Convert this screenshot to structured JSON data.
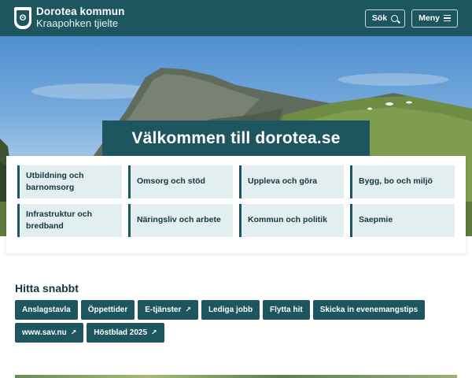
{
  "header": {
    "title": "Dorotea kommun",
    "subtitle": "Kraapohken tjielte",
    "search_label": "Sök",
    "menu_label": "Meny",
    "crest_icon": "bear-crest-icon",
    "bg_color": "#1e5660"
  },
  "hero": {
    "title": "Välkommen till dorotea.se"
  },
  "categories": [
    {
      "label": "Utbildning och barnomsorg"
    },
    {
      "label": "Omsorg och stöd"
    },
    {
      "label": "Uppleva och göra"
    },
    {
      "label": "Bygg, bo och miljö"
    },
    {
      "label": "Infrastruktur och bredband"
    },
    {
      "label": "Näringsliv och arbete"
    },
    {
      "label": "Kommun och politik"
    },
    {
      "label": "Saepmie"
    }
  ],
  "quick_links": {
    "title": "Hitta snabbt",
    "items": [
      {
        "label": "Anslagstavla",
        "external": false
      },
      {
        "label": "Öppettider",
        "external": false
      },
      {
        "label": "E-tjänster",
        "external": true
      },
      {
        "label": "Lediga jobb",
        "external": false
      },
      {
        "label": "Flytta hit",
        "external": false
      },
      {
        "label": "Skicka in evenemangstips",
        "external": false
      },
      {
        "label": "www.sav.nu",
        "external": true
      },
      {
        "label": "Höstblad 2025",
        "external": true
      }
    ],
    "external_glyph": "↗"
  }
}
